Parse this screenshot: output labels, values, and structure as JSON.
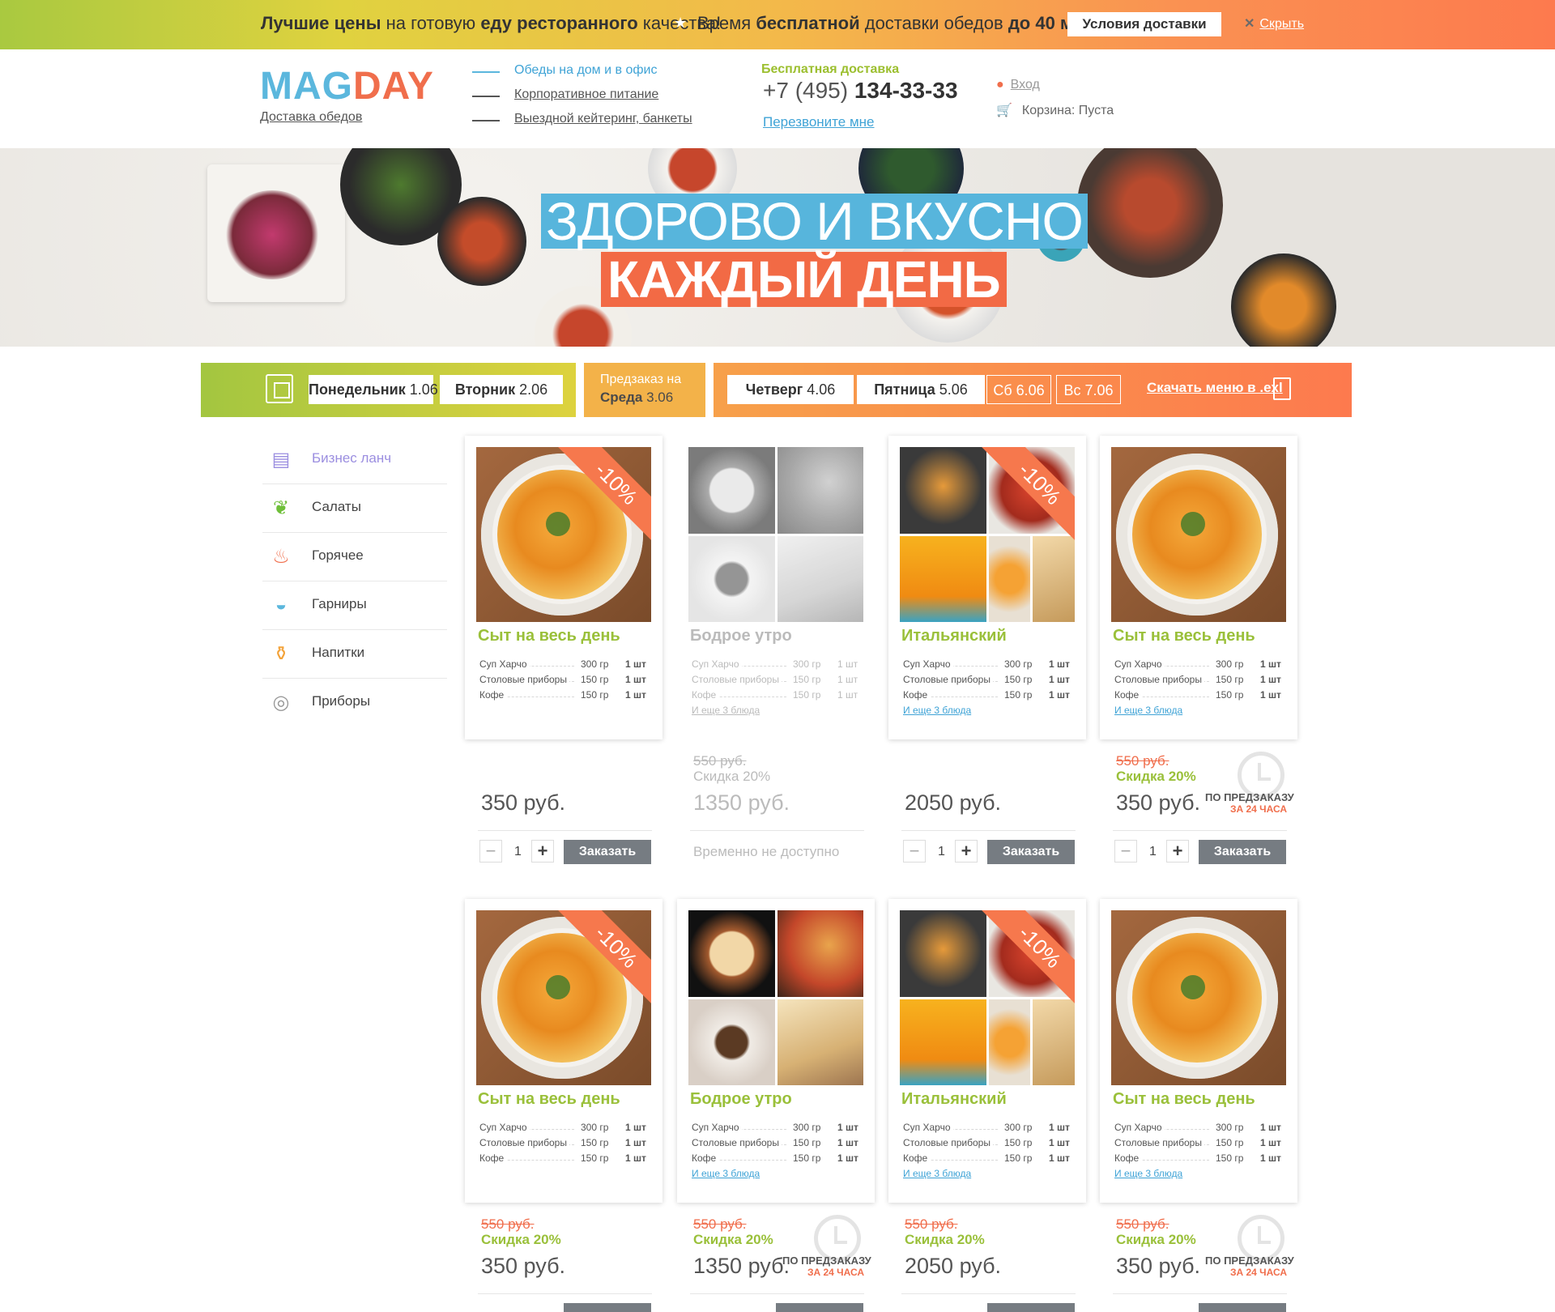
{
  "banner": {
    "part1_bold": "Лучшие цены",
    "part1_text": "на готовую",
    "part1_bold2": "еду ресторанного",
    "part1_end": "качества!",
    "part2_text": "Время",
    "part2_bold": "бесплатной",
    "part2_text2": "доставки обедов",
    "part2_bold2": "до 40 мин.",
    "conditions_btn": "Условия доставки",
    "hide_label": "Скрыть",
    "hide_x": "✕"
  },
  "header": {
    "logo_m": "MAG",
    "logo_d": "DAY",
    "logo_sub": "Доставка обедов",
    "nav": [
      "Обеды на дом и в офис",
      "Корпоративное питание",
      "Выездной кейтеринг, банкеты"
    ],
    "free_delivery": "Бесплатная доставка",
    "phone_prefix": "+7 (495)",
    "phone_number": "134-33-33",
    "callback": "Перезвоните мне",
    "login": "Вход",
    "cart_label": "Корзина:",
    "cart_value": "Пуста"
  },
  "hero": {
    "line1": "ЗДОРОВО И ВКУСНО",
    "line2": "КАЖДЫЙ ДЕНЬ"
  },
  "days": {
    "mon_name": "Понедельник",
    "mon_date": "1.06",
    "tue_name": "Вторник",
    "tue_date": "2.06",
    "pre_label": "Предзаказ на",
    "wed_name": "Среда",
    "wed_date": "3.06",
    "thu_name": "Четверг",
    "thu_date": "4.06",
    "fri_name": "Пятница",
    "fri_date": "5.06",
    "sat": "Сб 6.06",
    "sun": "Вс 7.06",
    "download": "Скачать меню в .exl"
  },
  "categories": [
    "Бизнес ланч",
    "Салаты",
    "Горячее",
    "Гарниры",
    "Напитки",
    "Приборы"
  ],
  "rows": [
    {
      "name": "Суп Харчо",
      "w": "300 гр",
      "q": "1 шт"
    },
    {
      "name": "Столовые приборы",
      "w": "150 гр",
      "q": "1 шт"
    },
    {
      "name": "Кофе",
      "w": "150 гр",
      "q": "1 шт"
    }
  ],
  "cards": [
    {
      "title": "Сыт на весь день",
      "badge": "-10%",
      "price": "350 руб.",
      "qty": "1",
      "btn": "Заказать"
    },
    {
      "title": "Бодрое утро",
      "more": "И еще 3 блюда",
      "old": "550 руб.",
      "disc": "Скидка 20%",
      "price": "1350 руб.",
      "na": "Временно не доступно"
    },
    {
      "title": "Итальянский",
      "badge": "-10%",
      "more": "И еще 3 блюда",
      "price": "2050 руб.",
      "qty": "1",
      "btn": "Заказать"
    },
    {
      "title": "Сыт на весь день",
      "more": "И еще 3 блюда",
      "old": "550 руб.",
      "disc": "Скидка 20%",
      "price": "350 руб.",
      "qty": "1",
      "btn": "Заказать",
      "pre1": "ПО ПРЕДЗАКАЗУ",
      "pre2": "ЗА 24 ЧАСА"
    },
    {
      "title": "Сыт на весь день",
      "badge": "-10%",
      "old": "550 руб.",
      "disc": "Скидка 20%",
      "price": "350 руб."
    },
    {
      "title": "Бодрое утро",
      "more": "И еще 3 блюда",
      "old": "550 руб.",
      "disc": "Скидка 20%",
      "price": "1350 руб.",
      "pre1": "ПО ПРЕДЗАКАЗУ",
      "pre2": "ЗА 24 ЧАСА"
    },
    {
      "title": "Итальянский",
      "badge": "-10%",
      "more": "И еще 3 блюда",
      "old": "550 руб.",
      "disc": "Скидка 20%",
      "price": "2050 руб."
    },
    {
      "title": "Сыт на весь день",
      "more": "И еще 3 блюда",
      "old": "550 руб.",
      "disc": "Скидка 20%",
      "price": "350 руб.",
      "pre1": "ПО ПРЕДЗАКАЗУ",
      "pre2": "ЗА 24 ЧАСА"
    }
  ],
  "colors": {
    "accent_green": "#9ac03a",
    "accent_orange": "#f06e4c",
    "accent_blue": "#5bb7dd",
    "button_gray": "#767c82"
  }
}
